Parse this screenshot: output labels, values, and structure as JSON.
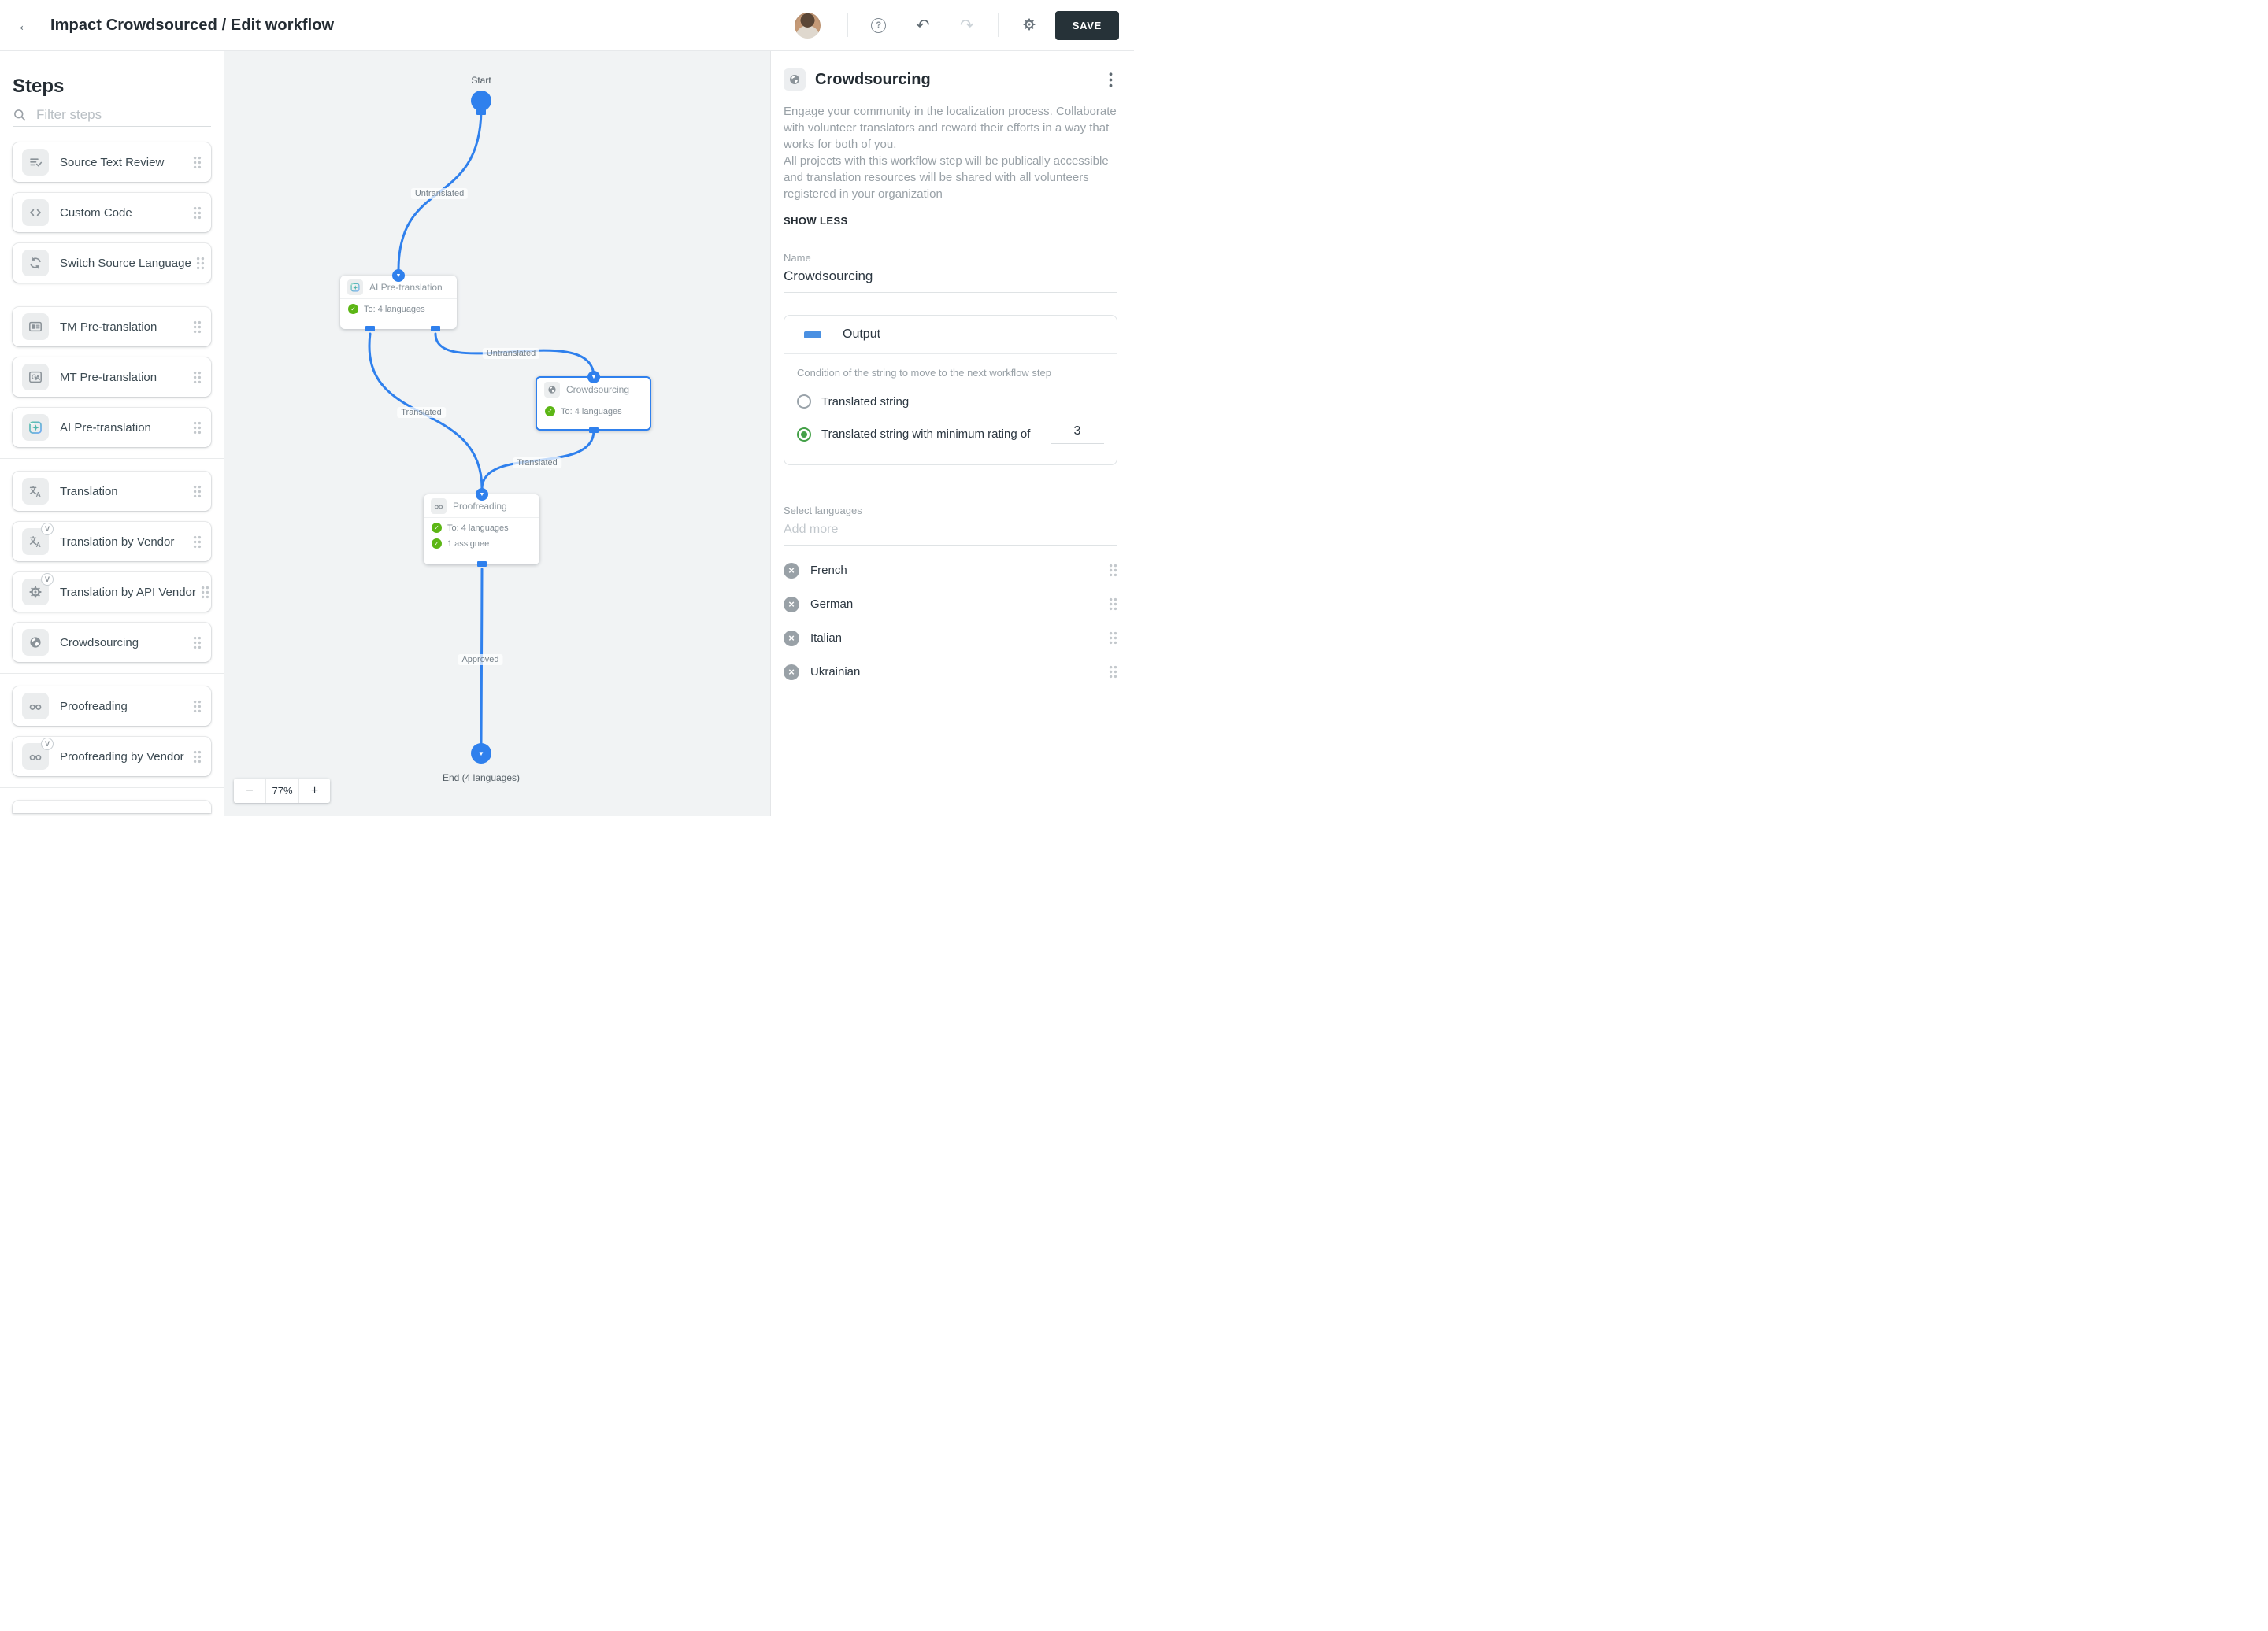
{
  "topbar": {
    "title": "Impact Crowdsourced / Edit workflow",
    "back_icon": "back-arrow-icon",
    "help_icon": "help-icon",
    "undo_icon": "undo-icon",
    "redo_icon": "redo-icon",
    "settings_icon": "gear-icon",
    "save_label": "SAVE"
  },
  "sidebar": {
    "heading": "Steps",
    "filter_placeholder": "Filter steps",
    "search_icon": "search-icon",
    "groups": [
      {
        "items": [
          {
            "label": "Source Text Review",
            "icon": "list-check-icon"
          },
          {
            "label": "Custom Code",
            "icon": "code-icon"
          },
          {
            "label": "Switch Source Language",
            "icon": "refresh-icon"
          }
        ]
      },
      {
        "items": [
          {
            "label": "TM Pre-translation",
            "icon": "tm-card-icon"
          },
          {
            "label": "MT Pre-translation",
            "icon": "mt-translate-icon"
          },
          {
            "label": "AI Pre-translation",
            "icon": "ai-sparkle-icon"
          }
        ]
      },
      {
        "items": [
          {
            "label": "Translation",
            "icon": "translate-icon"
          },
          {
            "label": "Translation by Vendor",
            "icon": "translate-icon",
            "vendor": true
          },
          {
            "label": "Translation by API Vendor",
            "icon": "gear-icon",
            "vendor": true
          },
          {
            "label": "Crowdsourcing",
            "icon": "globe-icon"
          }
        ]
      },
      {
        "items": [
          {
            "label": "Proofreading",
            "icon": "glasses-icon"
          },
          {
            "label": "Proofreading by Vendor",
            "icon": "glasses-icon",
            "vendor": true
          }
        ]
      }
    ]
  },
  "canvas": {
    "start": {
      "label": "Start"
    },
    "end": {
      "label": "End (4 languages)"
    },
    "nodes": [
      {
        "title": "AI Pre-translation",
        "icon": "ai-sparkle-icon",
        "rows": [
          "To: 4 languages"
        ]
      },
      {
        "title": "Crowdsourcing",
        "icon": "globe-icon",
        "rows": [
          "To: 4 languages"
        ],
        "selected": true
      },
      {
        "title": "Proofreading",
        "icon": "glasses-icon",
        "rows": [
          "To: 4 languages",
          "1 assignee"
        ]
      }
    ],
    "edge_labels": {
      "start_to_ai": "Untranslated",
      "ai_to_crowdsourcing": "Untranslated",
      "ai_to_proofreading": "Translated",
      "crowdsourcing_to_proofreading": "Translated",
      "proofreading_to_end": "Approved"
    },
    "zoom_out": "−",
    "zoom_level": "77%",
    "zoom_in": "+"
  },
  "panel": {
    "icon": "globe-icon",
    "title": "Crowdsourcing",
    "menu_icon": "kebab-icon",
    "description_p1": "Engage your community in the localization process. Collaborate with volunteer translators and reward their efforts in a way that works for both of you.",
    "description_p2": "All projects with this workflow step will be publically accessible and translation resources will be shared with all volunteers registered in your organization",
    "show_less": "SHOW LESS",
    "name_label": "Name",
    "name_value": "Crowdsourcing",
    "output": {
      "title": "Output",
      "condition_label": "Condition of the string to move to the next workflow step",
      "radio_1": "Translated string",
      "radio_2": "Translated string with minimum rating of",
      "rating_value": "3"
    },
    "languages_label": "Select languages",
    "add_more_placeholder": "Add more",
    "languages": [
      "French",
      "German",
      "Italian",
      "Ukrainian"
    ]
  },
  "colors": {
    "accent_blue": "#2F80ED",
    "success_green": "#5CB615",
    "radio_green": "#43A047",
    "save_button_dark": "#263238",
    "canvas_background": "#F1F3F4"
  }
}
